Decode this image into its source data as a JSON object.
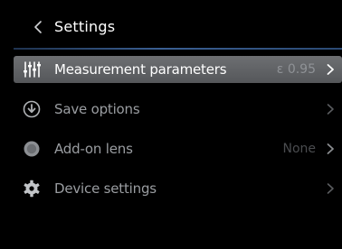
{
  "header": {
    "title": "Settings",
    "back_icon": "chevron-left-icon"
  },
  "menu": {
    "items": [
      {
        "label": "Measurement parameters",
        "value": "ε 0.95",
        "icon": "sliders-icon",
        "selected": true
      },
      {
        "label": "Save options",
        "value": "",
        "icon": "download-circle-icon",
        "selected": false
      },
      {
        "label": "Add-on lens",
        "value": "None",
        "icon": "lens-icon",
        "selected": false
      },
      {
        "label": "Device settings",
        "value": "",
        "icon": "gear-icon",
        "selected": false
      }
    ]
  },
  "colors": {
    "background": "#000000",
    "selected_row": "#5f6164",
    "header_rule": "#3a5f93",
    "text_primary": "#ffffff",
    "text_secondary": "#9a9da1"
  }
}
